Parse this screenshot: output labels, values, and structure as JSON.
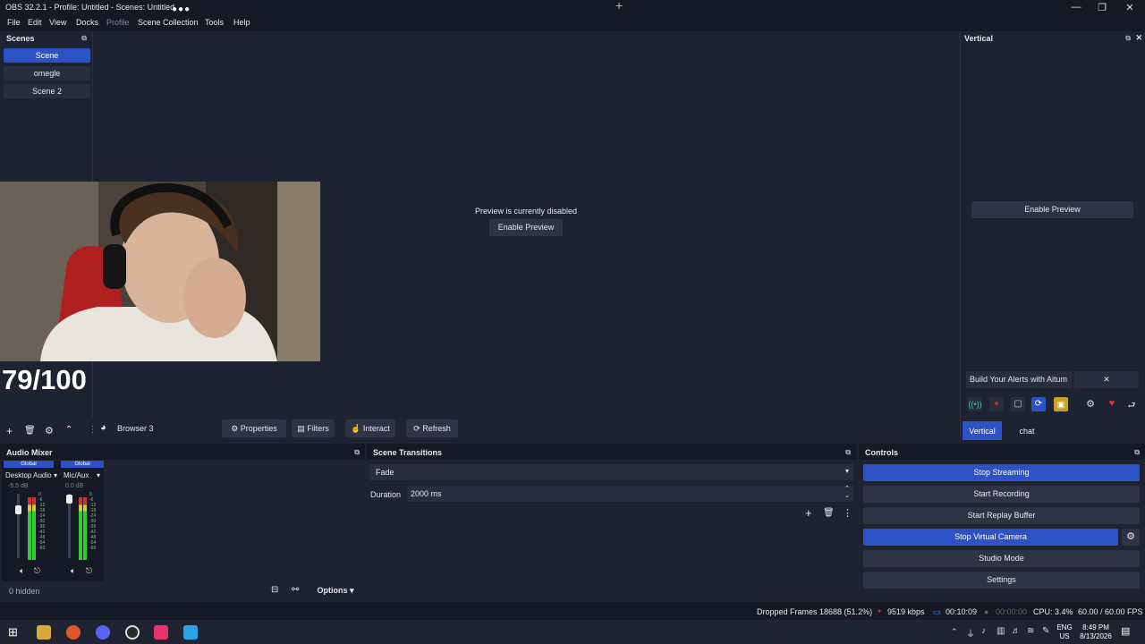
{
  "window": {
    "title": "OBS 32.2.1 - Profile: Untitled - Scenes: Untitled",
    "minimize": "—",
    "maximize": "❐",
    "close": "✕"
  },
  "menu": [
    "File",
    "Edit",
    "View",
    "Docks",
    "Profile",
    "Scene Collection",
    "Tools",
    "Help"
  ],
  "scenes": {
    "title": "Scenes",
    "items": [
      "Scene",
      "omegle",
      "Scene 2"
    ],
    "active_index": 0
  },
  "overlay": {
    "score": "79/100"
  },
  "preview": {
    "message": "Preview is currently disabled",
    "enable_label": "Enable Preview"
  },
  "vertical": {
    "title": "Vertical",
    "enable_label": "Enable Preview",
    "banner": "Build Your Alerts with Aitum",
    "tabs": [
      "Vertical",
      "chat"
    ],
    "active_tab": 0
  },
  "source_toolbar": {
    "source_name": "Browser 3",
    "properties": "Properties",
    "filters": "Filters",
    "interact": "Interact",
    "refresh": "Refresh"
  },
  "audio_mixer": {
    "title": "Audio Mixer",
    "channels": [
      {
        "badge": "Global",
        "name": "Desktop Audio",
        "db": "-5.5 dB",
        "level": 0.55
      },
      {
        "badge": "Global",
        "name": "Mic/Aux",
        "db": "0.0 dB",
        "level": 0.6
      }
    ],
    "scale": [
      "0",
      "-6",
      "-12",
      "-18",
      "-24",
      "-30",
      "-36",
      "-42",
      "-48",
      "-54",
      "-60"
    ],
    "hidden": "0 hidden",
    "options": "Options"
  },
  "transitions": {
    "title": "Scene Transitions",
    "selected": "Fade",
    "duration_label": "Duration",
    "duration_value": "2000 ms"
  },
  "controls": {
    "title": "Controls",
    "buttons": [
      "Stop Streaming",
      "Start Recording",
      "Start Replay Buffer",
      "Stop Virtual Camera",
      "Studio Mode",
      "Settings"
    ]
  },
  "status": {
    "dropped": "Dropped Frames 18688 (51.2%)",
    "bitrate": "9519 kbps",
    "stream_time": "00:10:09",
    "rec_time": "00:00:00",
    "cpu": "CPU: 3.4%",
    "fps": "60.00 / 60.00 FPS"
  },
  "taskbar": {
    "lang": "ENG",
    "region": "US",
    "time": "8:49 PM",
    "date": "8/13/2026"
  },
  "colors": {
    "accent": "#2c52c5",
    "panel": "#1d2331",
    "title_bar": "#151925",
    "button": "#2d3445"
  }
}
